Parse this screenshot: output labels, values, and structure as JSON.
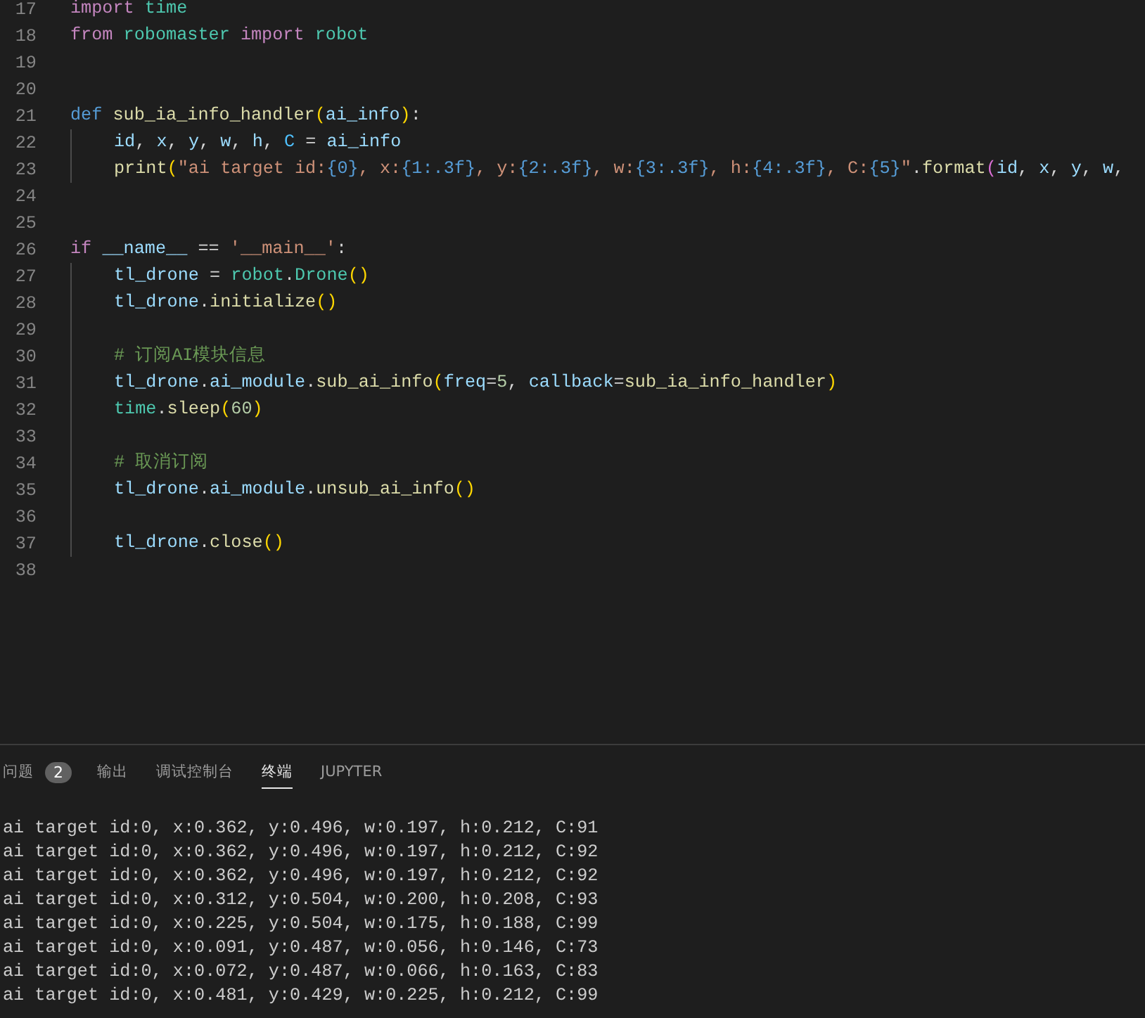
{
  "editor": {
    "lines": [
      {
        "number": "17",
        "indented": false,
        "tokens": [
          {
            "kind": "kw",
            "text": "import "
          },
          {
            "kind": "mod",
            "text": "time"
          }
        ]
      },
      {
        "number": "18",
        "indented": false,
        "tokens": [
          {
            "kind": "kw",
            "text": "from "
          },
          {
            "kind": "mod",
            "text": "robomaster "
          },
          {
            "kind": "kw",
            "text": "import "
          },
          {
            "kind": "mod",
            "text": "robot"
          }
        ]
      },
      {
        "number": "19",
        "indented": false
      },
      {
        "number": "20",
        "indented": false
      },
      {
        "number": "21",
        "indented": false,
        "tokens": [
          {
            "kind": "def",
            "text": "def "
          },
          {
            "kind": "fn",
            "text": "sub_ia_info_handler"
          },
          {
            "kind": "paren",
            "text": "("
          },
          {
            "kind": "var",
            "text": "ai_info"
          },
          {
            "kind": "paren",
            "text": ")"
          },
          {
            "kind": "plain",
            "text": ":"
          }
        ]
      },
      {
        "number": "22",
        "indented": true,
        "tokens": [
          {
            "kind": "var",
            "text": "id"
          },
          {
            "kind": "plain",
            "text": ", "
          },
          {
            "kind": "var",
            "text": "x"
          },
          {
            "kind": "plain",
            "text": ", "
          },
          {
            "kind": "var",
            "text": "y"
          },
          {
            "kind": "plain",
            "text": ", "
          },
          {
            "kind": "var",
            "text": "w"
          },
          {
            "kind": "plain",
            "text": ", "
          },
          {
            "kind": "var",
            "text": "h"
          },
          {
            "kind": "plain",
            "text": ", "
          },
          {
            "kind": "const",
            "text": "C"
          },
          {
            "kind": "plain",
            "text": " = "
          },
          {
            "kind": "var",
            "text": "ai_info"
          }
        ]
      },
      {
        "number": "23",
        "indented": true,
        "tokens": [
          {
            "kind": "fn",
            "text": "print"
          },
          {
            "kind": "paren",
            "text": "("
          },
          {
            "kind": "str",
            "text": "\"ai target id:"
          },
          {
            "kind": "fmt",
            "text": "{0}"
          },
          {
            "kind": "str",
            "text": ", x:"
          },
          {
            "kind": "fmt",
            "text": "{1:.3f}"
          },
          {
            "kind": "str",
            "text": ", y:"
          },
          {
            "kind": "fmt",
            "text": "{2:.3f}"
          },
          {
            "kind": "str",
            "text": ", w:"
          },
          {
            "kind": "fmt",
            "text": "{3:.3f}"
          },
          {
            "kind": "str",
            "text": ", h:"
          },
          {
            "kind": "fmt",
            "text": "{4:.3f}"
          },
          {
            "kind": "str",
            "text": ", C:"
          },
          {
            "kind": "fmt",
            "text": "{5}"
          },
          {
            "kind": "str",
            "text": "\""
          },
          {
            "kind": "plain",
            "text": "."
          },
          {
            "kind": "fn",
            "text": "format"
          },
          {
            "kind": "paren2",
            "text": "("
          },
          {
            "kind": "var",
            "text": "id"
          },
          {
            "kind": "plain",
            "text": ", "
          },
          {
            "kind": "var",
            "text": "x"
          },
          {
            "kind": "plain",
            "text": ", "
          },
          {
            "kind": "var",
            "text": "y"
          },
          {
            "kind": "plain",
            "text": ", "
          },
          {
            "kind": "var",
            "text": "w"
          },
          {
            "kind": "plain",
            "text": ","
          }
        ]
      },
      {
        "number": "24",
        "indented": false
      },
      {
        "number": "25",
        "indented": false
      },
      {
        "number": "26",
        "indented": false,
        "tokens": [
          {
            "kind": "kw",
            "text": "if "
          },
          {
            "kind": "var",
            "text": "__name__"
          },
          {
            "kind": "plain",
            "text": " == "
          },
          {
            "kind": "str",
            "text": "'__main__'"
          },
          {
            "kind": "plain",
            "text": ":"
          }
        ]
      },
      {
        "number": "27",
        "indented": true,
        "tokens": [
          {
            "kind": "var",
            "text": "tl_drone"
          },
          {
            "kind": "plain",
            "text": " = "
          },
          {
            "kind": "mod",
            "text": "robot"
          },
          {
            "kind": "plain",
            "text": "."
          },
          {
            "kind": "mod",
            "text": "Drone"
          },
          {
            "kind": "paren",
            "text": "()"
          }
        ]
      },
      {
        "number": "28",
        "indented": true,
        "tokens": [
          {
            "kind": "var",
            "text": "tl_drone"
          },
          {
            "kind": "plain",
            "text": "."
          },
          {
            "kind": "fn",
            "text": "initialize"
          },
          {
            "kind": "paren",
            "text": "()"
          }
        ]
      },
      {
        "number": "29",
        "indented": true
      },
      {
        "number": "30",
        "indented": true,
        "tokens": [
          {
            "kind": "cmt",
            "text": "# 订阅AI模块信息"
          }
        ]
      },
      {
        "number": "31",
        "indented": true,
        "tokens": [
          {
            "kind": "var",
            "text": "tl_drone"
          },
          {
            "kind": "plain",
            "text": "."
          },
          {
            "kind": "var",
            "text": "ai_module"
          },
          {
            "kind": "plain",
            "text": "."
          },
          {
            "kind": "fn",
            "text": "sub_ai_info"
          },
          {
            "kind": "paren",
            "text": "("
          },
          {
            "kind": "var",
            "text": "freq"
          },
          {
            "kind": "plain",
            "text": "="
          },
          {
            "kind": "num",
            "text": "5"
          },
          {
            "kind": "plain",
            "text": ", "
          },
          {
            "kind": "var",
            "text": "callback"
          },
          {
            "kind": "plain",
            "text": "="
          },
          {
            "kind": "fn",
            "text": "sub_ia_info_handler"
          },
          {
            "kind": "paren",
            "text": ")"
          }
        ]
      },
      {
        "number": "32",
        "indented": true,
        "tokens": [
          {
            "kind": "mod",
            "text": "time"
          },
          {
            "kind": "plain",
            "text": "."
          },
          {
            "kind": "fn",
            "text": "sleep"
          },
          {
            "kind": "paren",
            "text": "("
          },
          {
            "kind": "num",
            "text": "60"
          },
          {
            "kind": "paren",
            "text": ")"
          }
        ]
      },
      {
        "number": "33",
        "indented": true
      },
      {
        "number": "34",
        "indented": true,
        "tokens": [
          {
            "kind": "cmt",
            "text": "# 取消订阅"
          }
        ]
      },
      {
        "number": "35",
        "indented": true,
        "tokens": [
          {
            "kind": "var",
            "text": "tl_drone"
          },
          {
            "kind": "plain",
            "text": "."
          },
          {
            "kind": "var",
            "text": "ai_module"
          },
          {
            "kind": "plain",
            "text": "."
          },
          {
            "kind": "fn",
            "text": "unsub_ai_info"
          },
          {
            "kind": "paren",
            "text": "()"
          }
        ]
      },
      {
        "number": "36",
        "indented": true
      },
      {
        "number": "37",
        "indented": true,
        "tokens": [
          {
            "kind": "var",
            "text": "tl_drone"
          },
          {
            "kind": "plain",
            "text": "."
          },
          {
            "kind": "fn",
            "text": "close"
          },
          {
            "kind": "paren",
            "text": "()"
          }
        ]
      },
      {
        "number": "38",
        "indented": false
      }
    ]
  },
  "panel": {
    "tabs": [
      {
        "label": "问题",
        "badge": "2",
        "selected": false
      },
      {
        "label": "输出",
        "selected": false
      },
      {
        "label": "调试控制台",
        "selected": false
      },
      {
        "label": "终端",
        "selected": true
      },
      {
        "label": "JUPYTER",
        "selected": false
      }
    ],
    "terminal_lines": [
      "ai target id:0, x:0.362, y:0.496, w:0.197, h:0.212, C:91",
      "ai target id:0, x:0.362, y:0.496, w:0.197, h:0.212, C:92",
      "ai target id:0, x:0.362, y:0.496, w:0.197, h:0.212, C:92",
      "ai target id:0, x:0.312, y:0.504, w:0.200, h:0.208, C:93",
      "ai target id:0, x:0.225, y:0.504, w:0.175, h:0.188, C:99",
      "ai target id:0, x:0.091, y:0.487, w:0.056, h:0.146, C:73",
      "ai target id:0, x:0.072, y:0.487, w:0.066, h:0.163, C:83",
      "ai target id:0, x:0.481, y:0.429, w:0.225, h:0.212, C:99"
    ]
  }
}
